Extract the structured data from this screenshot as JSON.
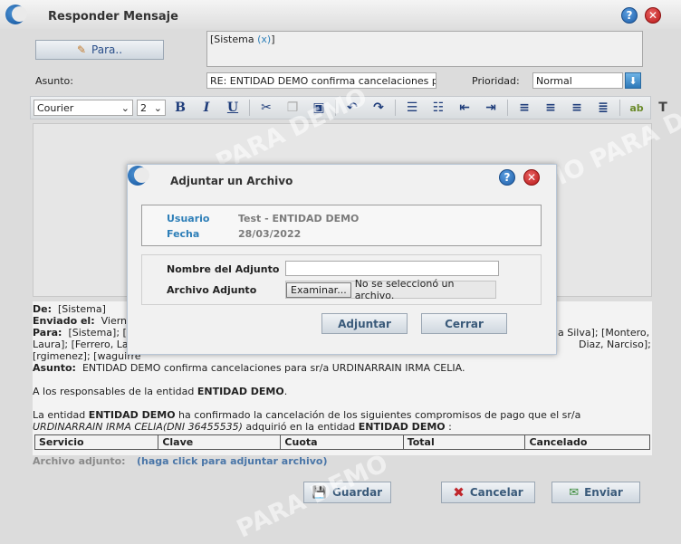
{
  "window": {
    "title": "Responder Mensaje"
  },
  "compose": {
    "to_button": "Para..",
    "to_recipient": "[Sistema",
    "to_remove": "(x)",
    "to_close": "]",
    "subject_label": "Asunto:",
    "subject_value": "RE: ENTIDAD DEMO confirma cancelaciones para sr/",
    "priority_label": "Prioridad:",
    "priority_value": "Normal"
  },
  "toolbar": {
    "font": "Courier",
    "size": "2",
    "buttons": [
      "bold",
      "italic",
      "underline",
      "cut",
      "copy",
      "paste",
      "undo",
      "redo",
      "ordered-list",
      "unordered-list",
      "outdent",
      "indent",
      "align-left",
      "align-center",
      "align-right",
      "justify",
      "highlight",
      "text-color"
    ]
  },
  "mail": {
    "de_label": "De:",
    "de_value": "[Sistema]",
    "enviado_label": "Enviado el:",
    "enviado_value": "Vierne",
    "para_label": "Para:",
    "para_value_start": "[Sistema]; [P",
    "para_value_right": "da Silva]; [Montero,",
    "para_line2_left": "Laura]; [Ferrero, Lau",
    "para_line2_right": "Diaz, Narciso];",
    "para_line3": "[rgimenez]; [waguirre",
    "asunto_label": "Asunto:",
    "asunto_value": "ENTIDAD DEMO confirma cancelaciones para sr/a URDINARRAIN IRMA CELIA.",
    "greeting_prefix": "A los responsables de la entidad ",
    "greeting_entity": "ENTIDAD DEMO",
    "greeting_suffix": ".",
    "body_prefix": "La entidad ",
    "body_entity": "ENTIDAD DEMO",
    "body_mid": " ha confirmado la cancelación de los siguientes compromisos de pago que el sr/a ",
    "body_person": "URDINARRAIN IRMA CELIA(DNI 36455535)",
    "body_mid2": " adquirió en la entidad ",
    "body_entity2": "ENTIDAD DEMO",
    "body_end": " :",
    "table_headers": [
      "Servicio",
      "Clave",
      "Cuota",
      "Total",
      "Cancelado"
    ]
  },
  "attachment": {
    "label": "Archivo adjunto:",
    "link": "(haga click para adjuntar archivo)"
  },
  "actions": {
    "guardar": "Guardar",
    "cancelar": "Cancelar",
    "enviar": "Enviar"
  },
  "watermark": "PARA DEMO",
  "watermark_partial": "IO PARA DE",
  "modal": {
    "title": "Adjuntar un Archivo",
    "usuario_label": "Usuario",
    "usuario_value": "Test - ENTIDAD DEMO",
    "fecha_label": "Fecha",
    "fecha_value": "28/03/2022",
    "nombre_label": "Nombre del Adjunto",
    "nombre_value": "",
    "archivo_label": "Archivo Adjunto",
    "browse_button": "Examinar...",
    "no_file": "No se seleccionó un archivo.",
    "adjuntar": "Adjuntar",
    "cerrar": "Cerrar"
  },
  "colors": {
    "accent": "#2e7fb8",
    "link": "#4a76a8",
    "close_red": "#c0262c",
    "help_blue": "#1f5ea8"
  }
}
